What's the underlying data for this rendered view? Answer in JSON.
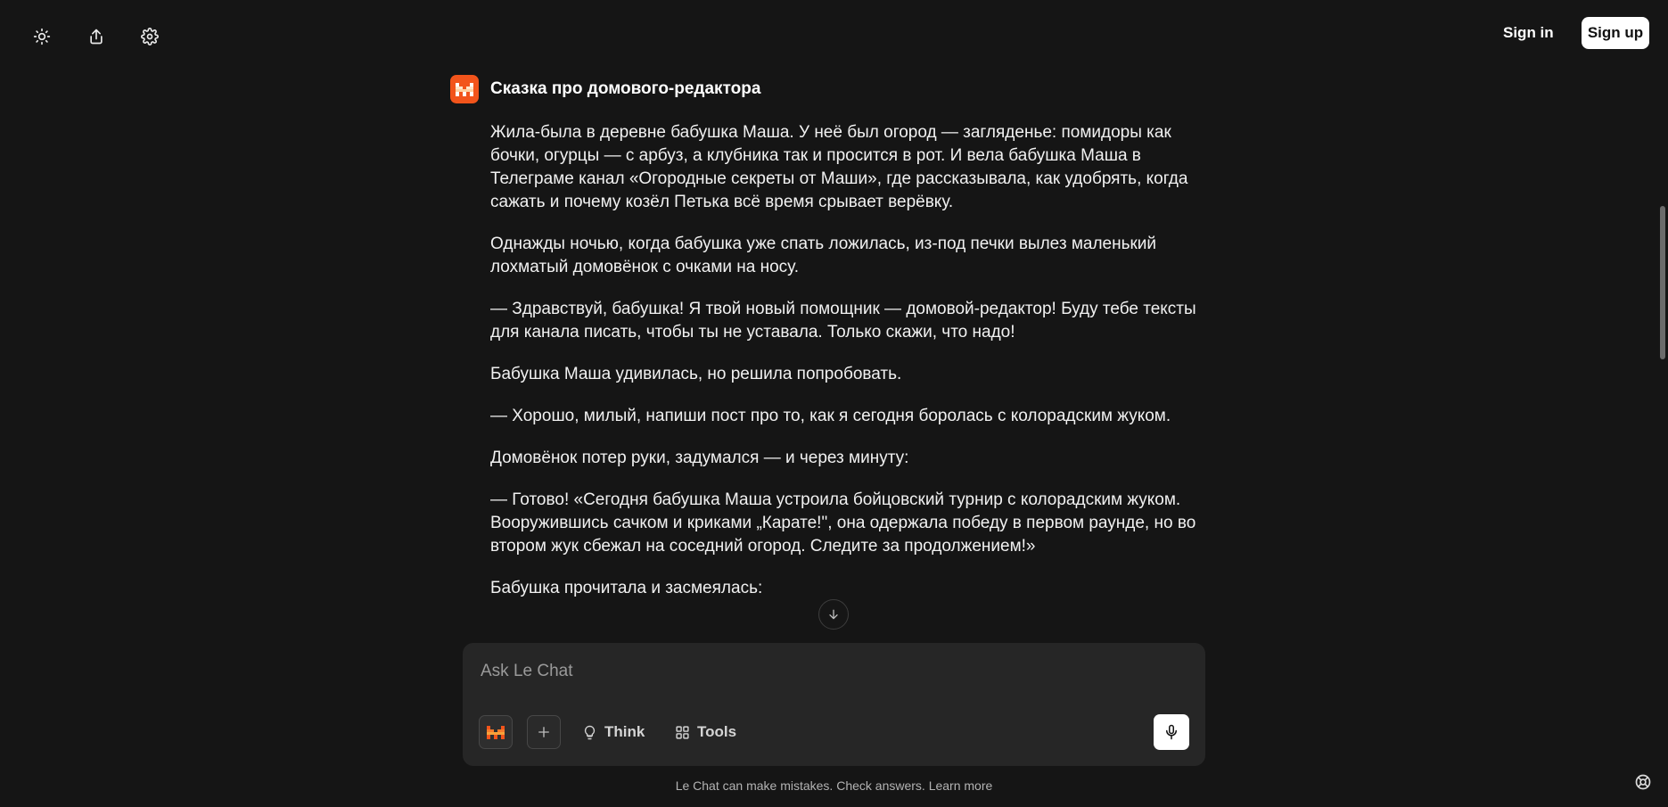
{
  "topbar": {
    "theme_icon": "sun-icon",
    "share_icon": "share-icon",
    "settings_icon": "gear-icon",
    "signin_label": "Sign in",
    "signup_label": "Sign up"
  },
  "chat": {
    "title": "Сказка про домового-редактора",
    "paragraphs": [
      "Жила-была в деревне бабушка Маша. У неё был огород — загляденье: помидоры как бочки, огурцы — с арбуз, а клубника так и просится в рот. И вела бабушка Маша в Телеграме канал «Огородные секреты от Маши», где рассказывала, как удобрять, когда сажать и почему козёл Петька всё время срывает верёвку.",
      "Однажды ночью, когда бабушка уже спать ложилась, из-под печки вылез маленький лохматый домовёнок с очками на носу.",
      "— Здравствуй, бабушка! Я твой новый помощник — домовой-редактор! Буду тебе тексты для канала писать, чтобы ты не уставала. Только скажи, что надо!",
      "Бабушка Маша удивилась, но решила попробовать.",
      "— Хорошо, милый, напиши пост про то, как я сегодня боролась с колорадским жуком.",
      "Домовёнок потер руки, задумался — и через минуту:",
      "— Готово! «Сегодня бабушка Маша устроила бойцовский турнир с колорадским жуком. Вооружившись сачком и криками „Карате!\", она одержала победу в первом раунде, но во втором жук сбежал на соседний огород. Следите за продолжением!»",
      "Бабушка прочитала и засмеялась:"
    ]
  },
  "composer": {
    "placeholder": "Ask Le Chat",
    "think_label": "Think",
    "tools_label": "Tools"
  },
  "footer": {
    "disclaimer": "Le Chat can make mistakes. Check answers.",
    "learn_more": "Learn more"
  },
  "colors": {
    "background": "#151515",
    "accent": "#f2541b",
    "composer": "#262626"
  }
}
